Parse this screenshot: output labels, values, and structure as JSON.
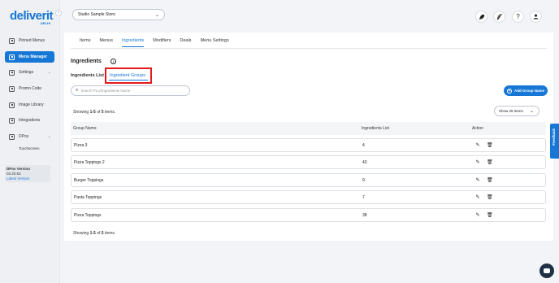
{
  "sidebar": {
    "logo": "deliverit",
    "logo_sub": "DELHI",
    "collapse_icon": "chevron-right-icon",
    "items": [
      {
        "label": "Pinned Menus",
        "icon": "pin-icon"
      },
      {
        "label": "Menu Manager",
        "icon": "menu-icon",
        "active": true
      },
      {
        "label": "Settings",
        "icon": "gear-icon"
      },
      {
        "label": "Promo Code",
        "icon": "ticket-icon"
      },
      {
        "label": "Image Library",
        "icon": "image-icon"
      },
      {
        "label": "Integrations",
        "icon": "plug-icon"
      },
      {
        "label": "DPos",
        "icon": "pos-icon"
      }
    ],
    "sub_items": [
      {
        "label": "Touchscreen"
      }
    ],
    "version": {
      "label": "DPos Version",
      "number": "02.20.53",
      "latest": "Latest Version"
    }
  },
  "topbar": {
    "store": "Studio Sample Store",
    "icons": [
      "rocket-icon",
      "feather-icon",
      "help-icon",
      "user-icon"
    ],
    "help": "?"
  },
  "tabs": [
    "Items",
    "Menus",
    "Ingredients",
    "Modifiers",
    "Deals",
    "Menu Settings"
  ],
  "active_tab": "Ingredients",
  "page": {
    "title": "Ingredients",
    "subtabs": [
      "Ingredients List",
      "Ingredient Groups"
    ],
    "active_subtab": "Ingredient Groups"
  },
  "search": {
    "placeholder": "Search PLU/Ingredients Name"
  },
  "add_button": "Add Group Name",
  "showing": {
    "prefix": "Showing",
    "range": "1-5",
    "of": "of",
    "total": "5",
    "suffix": "items."
  },
  "page_size": "Show 25 Items",
  "table": {
    "columns": [
      "Group Name",
      "Ingredients List",
      "Action"
    ],
    "rows": [
      {
        "name": "Pizza 3",
        "count": "4"
      },
      {
        "name": "Pizza Toppings 2",
        "count": "43"
      },
      {
        "name": "Burger Toppings",
        "count": "9"
      },
      {
        "name": "Pasta Toppings",
        "count": "7"
      },
      {
        "name": "Pizza Toppings",
        "count": "38"
      }
    ]
  },
  "feedback": "Feedback",
  "colors": {
    "accent": "#1677d6",
    "highlight": "#e5191e"
  }
}
